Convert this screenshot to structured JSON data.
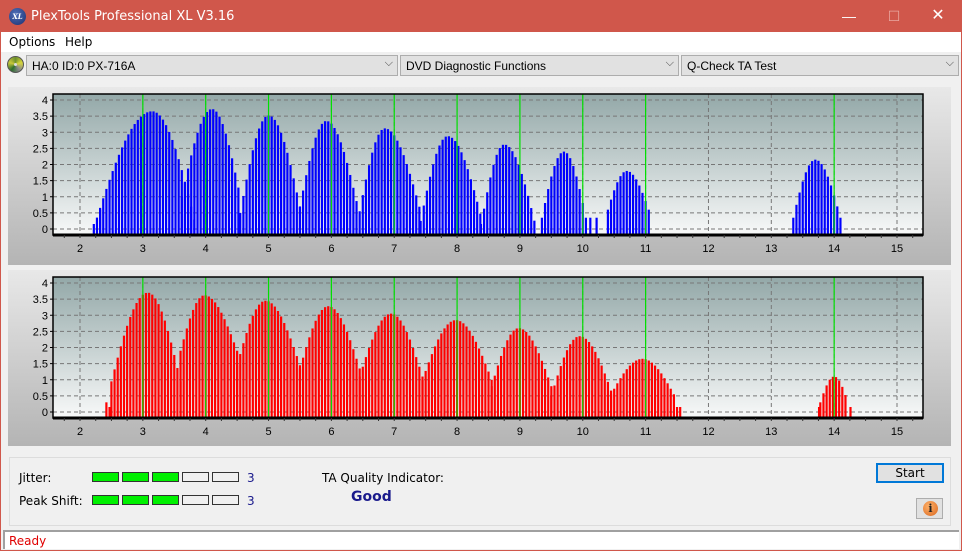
{
  "window": {
    "title": "PlexTools Professional XL V3.16",
    "app_icon_text": "XL",
    "controls": {
      "minimize": "—",
      "maximize": "☐",
      "close": "✕"
    },
    "titlebar_color": "#d0574b"
  },
  "menu": {
    "items": [
      "Options",
      "Help"
    ]
  },
  "toolbar": {
    "drive": "HA:0 ID:0  PX-716A",
    "function": "DVD Diagnostic Functions",
    "test": "Q-Check TA Test",
    "chevron": "⌵"
  },
  "metrics": {
    "jitter_label": "Jitter:",
    "jitter_value": "3",
    "jitter_level_of_5": 3,
    "peak_shift_label": "Peak Shift:",
    "peak_shift_value": "3",
    "peak_shift_level_of_5": 3,
    "quality_label": "TA Quality Indicator:",
    "quality_value": "Good"
  },
  "buttons": {
    "start": "Start",
    "info_icon": "i"
  },
  "status": {
    "text": "Ready"
  },
  "chart_data": [
    {
      "type": "bar",
      "name": "land-ta-histogram",
      "color": "#0000ff",
      "xlim": [
        1.6,
        15.4
      ],
      "ylim": [
        -0.15,
        4.2
      ],
      "xticks": [
        2,
        3,
        4,
        5,
        6,
        7,
        8,
        9,
        10,
        11,
        12,
        13,
        14,
        15
      ],
      "yticks": [
        0,
        0.5,
        1,
        1.5,
        2,
        2.5,
        3,
        3.5,
        4
      ],
      "ytick_labels": [
        "0",
        "0.5",
        "1",
        "1.5",
        "2",
        "2.5",
        "3",
        "3.5",
        "4"
      ],
      "marker_lines": [
        3,
        4,
        5,
        6,
        7,
        8,
        9,
        10,
        11,
        14
      ],
      "marker_color": "#00e000",
      "grid": true,
      "peaks": [
        {
          "center": 3.15,
          "height": 3.65,
          "left": 2.22,
          "right": 3.85,
          "floor": 0.05
        },
        {
          "center": 4.1,
          "height": 3.72,
          "left": 3.62,
          "right": 4.55,
          "floor": 1.0
        },
        {
          "center": 5.0,
          "height": 3.52,
          "left": 4.55,
          "right": 5.52,
          "floor": 0.5
        },
        {
          "center": 5.92,
          "height": 3.35,
          "left": 5.5,
          "right": 6.42,
          "floor": 0.7
        },
        {
          "center": 6.85,
          "height": 3.12,
          "left": 6.45,
          "right": 7.42,
          "floor": 0.55
        },
        {
          "center": 7.85,
          "height": 2.88,
          "left": 7.42,
          "right": 8.4,
          "floor": 0.25
        },
        {
          "center": 8.75,
          "height": 2.62,
          "left": 8.38,
          "right": 9.25,
          "floor": 0.1
        },
        {
          "center": 9.7,
          "height": 2.4,
          "left": 9.35,
          "right": 10.05,
          "floor": 0.35
        },
        {
          "center": 10.7,
          "height": 1.8,
          "left": 10.4,
          "right": 11.05,
          "floor": 0.6
        },
        {
          "center": 13.7,
          "height": 2.15,
          "left": 13.35,
          "right": 14.1,
          "floor": 0.35
        }
      ],
      "isolated_bars": [
        {
          "x": 2.32,
          "y": 0.6
        },
        {
          "x": 10.12,
          "y": 0.35
        },
        {
          "x": 10.22,
          "y": 0.35
        }
      ],
      "bar_spacing": 0.05
    },
    {
      "type": "bar",
      "name": "groove-ta-histogram",
      "color": "#ff0000",
      "xlim": [
        1.6,
        15.4
      ],
      "ylim": [
        -0.15,
        4.2
      ],
      "xticks": [
        2,
        3,
        4,
        5,
        6,
        7,
        8,
        9,
        10,
        11,
        12,
        13,
        14,
        15
      ],
      "yticks": [
        0,
        0.5,
        1,
        1.5,
        2,
        2.5,
        3,
        3.5,
        4
      ],
      "ytick_labels": [
        "0",
        "0.5",
        "1",
        "1.5",
        "2",
        "2.5",
        "3",
        "3.5",
        "4"
      ],
      "marker_lines": [
        3,
        4,
        5,
        6,
        7,
        8,
        9,
        10,
        11,
        14
      ],
      "marker_color": "#00e000",
      "grid": true,
      "peaks": [
        {
          "center": 3.08,
          "height": 3.7,
          "left": 2.5,
          "right": 3.6,
          "floor": 0.95
        },
        {
          "center": 3.98,
          "height": 3.62,
          "left": 3.6,
          "right": 4.5,
          "floor": 1.9
        },
        {
          "center": 4.95,
          "height": 3.45,
          "left": 4.5,
          "right": 5.5,
          "floor": 1.45
        },
        {
          "center": 5.95,
          "height": 3.28,
          "left": 5.5,
          "right": 6.45,
          "floor": 1.35
        },
        {
          "center": 6.95,
          "height": 3.05,
          "left": 6.45,
          "right": 7.45,
          "floor": 1.1
        },
        {
          "center": 7.98,
          "height": 2.85,
          "left": 7.45,
          "right": 8.55,
          "floor": 1.0
        },
        {
          "center": 8.98,
          "height": 2.6,
          "left": 8.55,
          "right": 9.5,
          "floor": 0.8
        },
        {
          "center": 9.95,
          "height": 2.35,
          "left": 9.5,
          "right": 10.48,
          "floor": 0.5
        },
        {
          "center": 10.95,
          "height": 1.65,
          "left": 10.45,
          "right": 11.45,
          "floor": 0.55
        },
        {
          "center": 14.0,
          "height": 1.1,
          "left": 13.78,
          "right": 14.22,
          "floor": 0.3
        }
      ],
      "isolated_bars": [
        {
          "x": 2.42,
          "y": 0.3
        },
        {
          "x": 2.47,
          "y": 0.0
        },
        {
          "x": 11.5,
          "y": 0.0
        },
        {
          "x": 11.55,
          "y": 0.0
        },
        {
          "x": 13.76,
          "y": 0.0
        },
        {
          "x": 14.26,
          "y": 0.0
        }
      ],
      "bar_spacing": 0.05
    }
  ]
}
